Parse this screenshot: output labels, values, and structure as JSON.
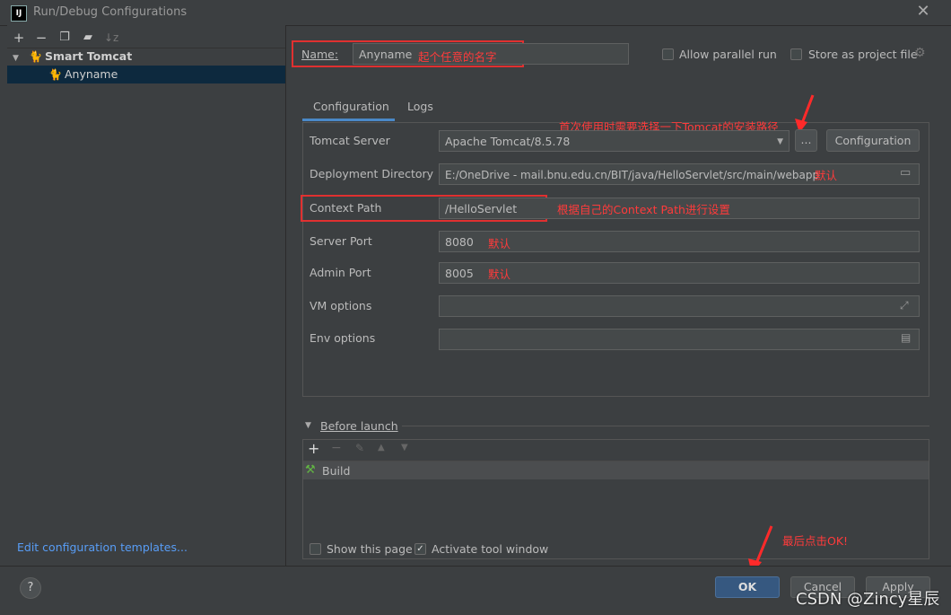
{
  "window": {
    "title": "Run/Debug Configurations",
    "app_icon": "IJ"
  },
  "left": {
    "toolbar": [
      "add-icon",
      "remove-icon",
      "copy-icon",
      "folder-icon",
      "sort-icon"
    ],
    "tree": [
      {
        "label": "Smart Tomcat",
        "group": true
      },
      {
        "label": "Anyname",
        "group": false
      }
    ],
    "edit_templates": "Edit configuration templates..."
  },
  "name_row": {
    "label": "Name:",
    "value": "Anyname",
    "annotation": "起个任意的名字",
    "allow_parallel": "Allow parallel run",
    "store_project": "Store as project file"
  },
  "tabs": [
    "Configuration",
    "Logs"
  ],
  "annotations": {
    "install_path": "首次使用时需要选择一下Tomcat的安装路径",
    "default": "默认",
    "context_hint": "根据自己的Context Path进行设置",
    "final": "最后点击OK!"
  },
  "fields": {
    "tomcat_server": {
      "label": "Tomcat Server",
      "value": "Apache Tomcat/8.5.78",
      "browse": "...",
      "config_btn": "Configuration"
    },
    "deployment_dir": {
      "label": "Deployment Directory",
      "value": "E:/OneDrive - mail.bnu.edu.cn/BIT/java/HelloServlet/src/main/webapp"
    },
    "context_path": {
      "label": "Context Path",
      "value": "/HelloServlet"
    },
    "server_port": {
      "label": "Server Port",
      "value": "8080"
    },
    "admin_port": {
      "label": "Admin Port",
      "value": "8005"
    },
    "vm_options": {
      "label": "VM options",
      "value": ""
    },
    "env_options": {
      "label": "Env options",
      "value": ""
    }
  },
  "before_launch": {
    "title": "Before launch",
    "items": [
      "Build"
    ]
  },
  "footer": {
    "show_page": "Show this page",
    "activate_tool": "Activate tool window",
    "ok": "OK",
    "cancel": "Cancel",
    "apply": "Apply",
    "help": "?"
  },
  "watermark": "CSDN @Zincy星辰",
  "colors": {
    "ok_button": "#365880",
    "annotation": "#ff3b3b",
    "background": "#3c3f41"
  }
}
